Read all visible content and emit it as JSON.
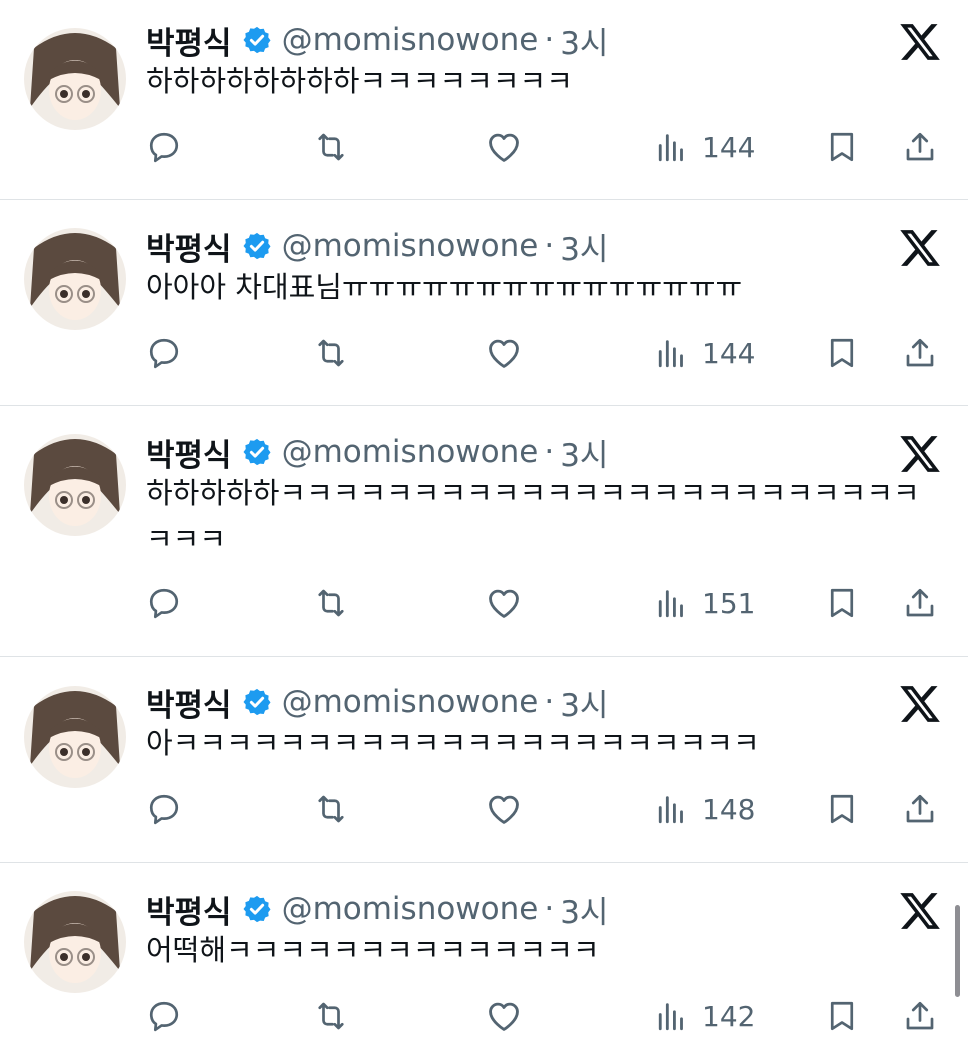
{
  "tweets": [
    {
      "name": "박평식",
      "handle": "@momisnowone",
      "dot": "·",
      "time": "3시",
      "text": "하하하하하하하하ㅋㅋㅋㅋㅋㅋㅋㅋ",
      "views": "144"
    },
    {
      "name": "박평식",
      "handle": "@momisnowone",
      "dot": "·",
      "time": "3시",
      "text": "아아아 차대표님ㅠㅠㅠㅠㅠㅠㅠㅠㅠㅠㅠㅠㅠㅠㅠ",
      "views": "144"
    },
    {
      "name": "박평식",
      "handle": "@momisnowone",
      "dot": "·",
      "time": "3시",
      "text": "하하하하하ㅋㅋㅋㅋㅋㅋㅋㅋㅋㅋㅋㅋㅋㅋㅋㅋㅋㅋㅋㅋㅋㅋㅋㅋㅋㅋㅋ",
      "views": "151"
    },
    {
      "name": "박평식",
      "handle": "@momisnowone",
      "dot": "·",
      "time": "3시",
      "text": "아ㅋㅋㅋㅋㅋㅋㅋㅋㅋㅋㅋㅋㅋㅋㅋㅋㅋㅋㅋㅋㅋㅋ",
      "views": "148"
    },
    {
      "name": "박평식",
      "handle": "@momisnowone",
      "dot": "·",
      "time": "3시",
      "text": "어떡해ㅋㅋㅋㅋㅋㅋㅋㅋㅋㅋㅋㅋㅋㅋ",
      "views": "142"
    }
  ],
  "colors": {
    "text": "#0f1419",
    "secondary": "#536471",
    "verified": "#1d9bf0",
    "divider": "#dfe3e6"
  },
  "icons": [
    "reply-icon",
    "retweet-icon",
    "like-icon",
    "views-icon",
    "bookmark-icon",
    "share-icon",
    "x-logo-icon",
    "verified-badge-icon"
  ]
}
